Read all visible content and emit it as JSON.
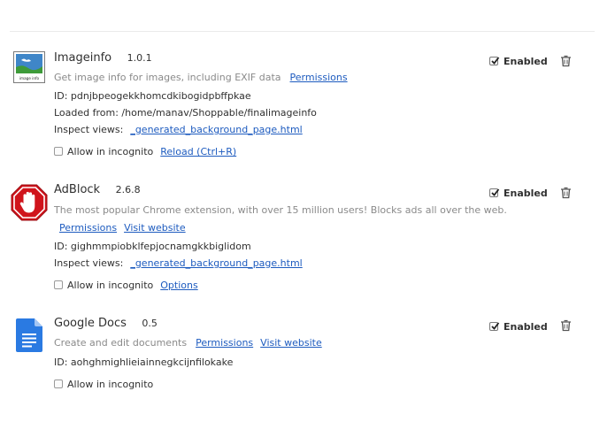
{
  "extensions": [
    {
      "name": "Imageinfo",
      "version": "1.0.1",
      "description": "Get image info for images, including EXIF data",
      "permissions_label": "Permissions",
      "id_text": "ID: pdnjbpeogekkhomcdkibogidpbffpkae",
      "loaded_from": "Loaded from: /home/manav/Shoppable/finalimageinfo",
      "inspect_label": "Inspect views:",
      "inspect_link": "_generated_background_page.html",
      "incognito_label": "Allow in incognito",
      "reload_label": "Reload (Ctrl+R)",
      "enabled_label": "Enabled",
      "enabled": true,
      "incognito_allowed": false,
      "icon": "image-info-icon"
    },
    {
      "name": "AdBlock",
      "version": "2.6.8",
      "description": "The most popular Chrome extension, with over 15 million users! Blocks ads all over the web.",
      "permissions_label": "Permissions",
      "website_label": "Visit website",
      "id_text": "ID: gighmmpiobklfepjocnamgkkbiglidom",
      "inspect_label": "Inspect views:",
      "inspect_link": "_generated_background_page.html",
      "incognito_label": "Allow in incognito",
      "options_label": "Options",
      "enabled_label": "Enabled",
      "enabled": true,
      "incognito_allowed": false,
      "icon": "adblock-stop-hand-icon"
    },
    {
      "name": "Google Docs",
      "version": "0.5",
      "description": "Create and edit documents",
      "permissions_label": "Permissions",
      "website_label": "Visit website",
      "id_text": "ID: aohghmighlieiainnegkcijnfilokake",
      "incognito_label": "Allow in incognito",
      "enabled_label": "Enabled",
      "enabled": true,
      "incognito_allowed": false,
      "icon": "google-docs-icon"
    }
  ],
  "colors": {
    "link": "#1d5bbf",
    "description": "#8a8a8a",
    "adblock_red": "#d0141c",
    "docs_blue": "#2a7ae2"
  },
  "icons": {
    "enabled_checkbox": "checkmark-icon",
    "remove": "trash-icon"
  }
}
